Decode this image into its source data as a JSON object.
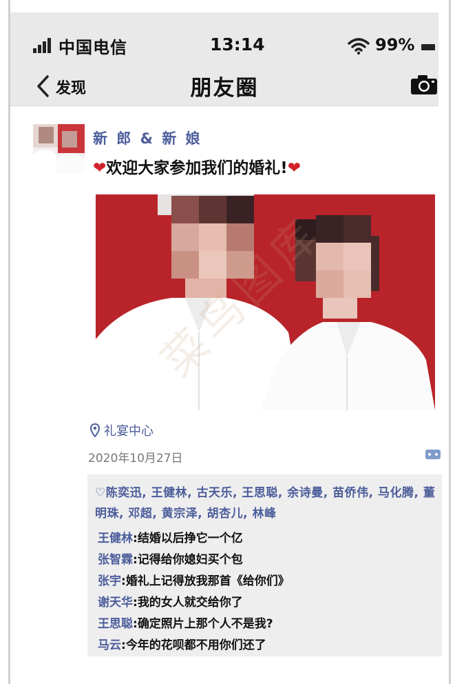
{
  "status_bar": {
    "carrier": "中国电信",
    "time": "13:14",
    "battery_pct": "99%"
  },
  "nav": {
    "back_label": "发现",
    "title": "朋友圈",
    "icons": [
      "chevron-left-icon",
      "camera-icon"
    ]
  },
  "post": {
    "author": "新 郎 & 新 娘",
    "text": "欢迎大家参加我们的婚礼!",
    "heart": "❤",
    "location": "礼宴中心",
    "date": "2020年10月27日",
    "likes_heart": "♡",
    "likes": "陈奕迅, 王健林, 古天乐, 王思聪, 余诗曼, 苗侨伟, 马化腾, 董明珠, 邓超, 黄宗泽, 胡杏儿, 林峰",
    "comments": [
      {
        "who": "王健林",
        "what": "结婚以后挣它一个亿"
      },
      {
        "who": "张智霖",
        "what": "记得给你媳妇买个包"
      },
      {
        "who": "张宇",
        "what": "婚礼上记得放我那首《给你们》"
      },
      {
        "who": "谢天华",
        "what": "我的女人就交给你了"
      },
      {
        "who": "王思聪",
        "what": "确定照片上那个人不是我?"
      },
      {
        "who": "马云",
        "what": "今年的花呗都不用你们还了"
      }
    ]
  },
  "watermark": "菜鸟图库",
  "colors": {
    "link_blue": "#4c5d9a",
    "photo_background": "#b8242a",
    "heart_red": "#d2232a",
    "header_gray": "#e9e9e9"
  }
}
